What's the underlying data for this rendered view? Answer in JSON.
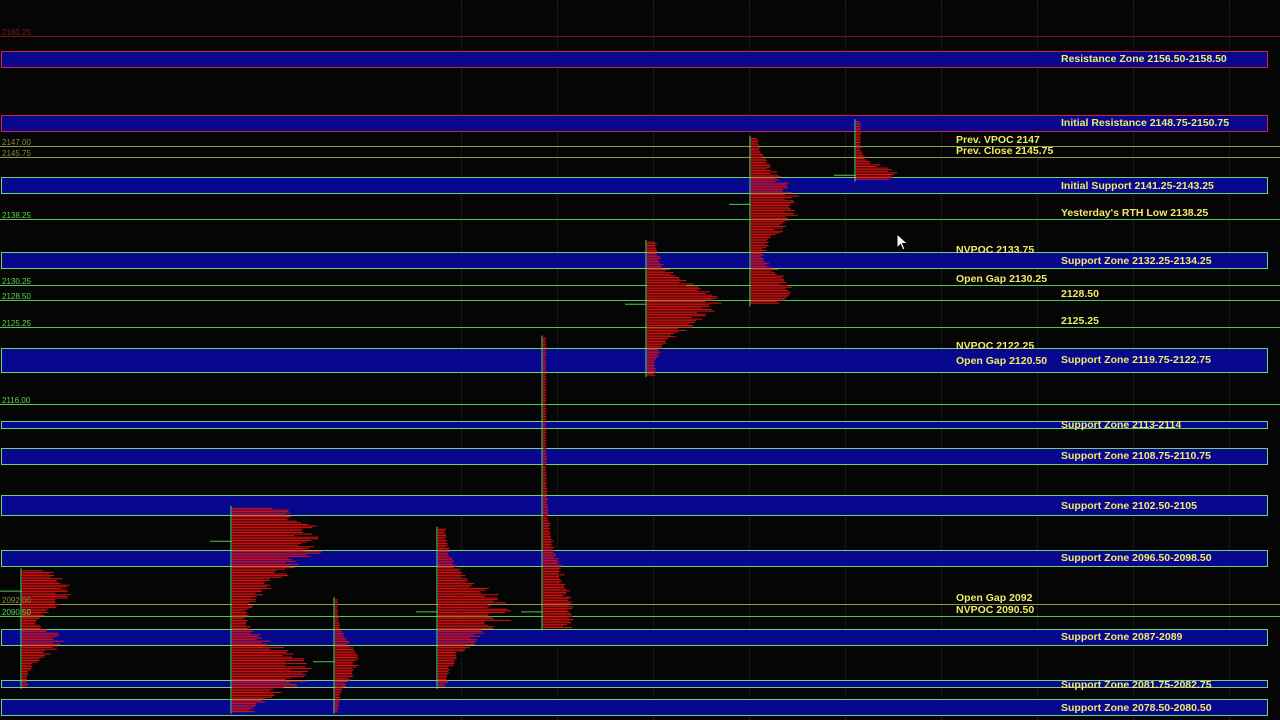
{
  "chart": {
    "price_axis": {
      "top": {
        "label": "2160.25",
        "value": 2160.25,
        "color": "#8b1a1a"
      },
      "bottom": {
        "value": 2078.0
      }
    },
    "price_labels": [
      {
        "label": "2160.25",
        "value": 2160.25,
        "color": "#8b1a1a"
      },
      {
        "label": "2147.00",
        "value": 2147.0,
        "color": "#8a8a3a"
      },
      {
        "label": "2145.75",
        "value": 2145.75,
        "color": "#8a8a3a"
      },
      {
        "label": "2138.25",
        "value": 2138.25,
        "color": "#58d858"
      },
      {
        "label": "2130.25",
        "value": 2130.25,
        "color": "#58d858"
      },
      {
        "label": "2128.50",
        "value": 2128.5,
        "color": "#58d858"
      },
      {
        "label": "2125.25",
        "value": 2125.25,
        "color": "#58d858"
      },
      {
        "label": "2116.00",
        "value": 2116.0,
        "color": "#58d858"
      },
      {
        "label": "2092.00",
        "value": 2092.0,
        "color": "#8a8a3a"
      },
      {
        "label": "2090.50",
        "value": 2090.5,
        "color": "#58d858"
      }
    ],
    "zones": [
      {
        "label": "Resistance Zone 2156.50-2158.50",
        "low": 2156.5,
        "high": 2158.5,
        "kind": "resistance"
      },
      {
        "label": "Initial Resistance 2148.75-2150.75",
        "low": 2148.75,
        "high": 2150.75,
        "kind": "resistance"
      },
      {
        "label": "Initial Support 2141.25-2143.25",
        "low": 2141.25,
        "high": 2143.25,
        "kind": "support"
      },
      {
        "label": "Support Zone 2132.25-2134.25",
        "low": 2132.25,
        "high": 2134.25,
        "kind": "support"
      },
      {
        "label": "Support Zone 2119.75-2122.75",
        "low": 2119.75,
        "high": 2122.75,
        "kind": "support"
      },
      {
        "label": "Support Zone 2113-2114",
        "low": 2113.0,
        "high": 2114.0,
        "kind": "support"
      },
      {
        "label": "Support Zone 2108.75-2110.75",
        "low": 2108.75,
        "high": 2110.75,
        "kind": "support"
      },
      {
        "label": "Support Zone 2102.50-2105",
        "low": 2102.5,
        "high": 2105.0,
        "kind": "support"
      },
      {
        "label": "Support Zone 2096.50-2098.50",
        "low": 2096.5,
        "high": 2098.5,
        "kind": "support"
      },
      {
        "label": "Support Zone 2087-2089",
        "low": 2087.0,
        "high": 2089.0,
        "kind": "support"
      },
      {
        "label": "Support Zone 2081.75-2082.75",
        "low": 2081.75,
        "high": 2082.75,
        "kind": "support"
      },
      {
        "label": "Support Zone 2078.50-2080.50",
        "low": 2078.5,
        "high": 2080.5,
        "kind": "support"
      }
    ],
    "levels": [
      {
        "label": "Prev. VPOC 2147",
        "value": 2147.0,
        "color": "#8f9a45"
      },
      {
        "label": "Prev. Close 2145.75",
        "value": 2145.75,
        "color": "#8f9a45"
      },
      {
        "label": "Yesterday's RTH Low 2138.25",
        "value": 2138.25,
        "color": "#4fc84f",
        "right": true
      },
      {
        "label": "NVPOC 2133.75",
        "value": 2133.75,
        "color": null
      },
      {
        "label": "Open Gap 2130.25",
        "value": 2130.25,
        "color": "#4fc84f"
      },
      {
        "label": "2128.50",
        "value": 2128.5,
        "color": "#4fc84f",
        "right": true
      },
      {
        "label": "2125.25",
        "value": 2125.25,
        "color": "#4fc84f",
        "right": true
      },
      {
        "label": "NVPOC 2122.25",
        "value": 2122.25,
        "color": null
      },
      {
        "label": "Open Gap 2120.50",
        "value": 2120.5,
        "color": null
      },
      {
        "label": "",
        "value": 2116.0,
        "color": "#4fc84f"
      },
      {
        "label": "Open Gap 2092",
        "value": 2092.0,
        "color": "#8f9a45"
      },
      {
        "label": "NVPOC 2090.50",
        "value": 2090.5,
        "color": "#4fc84f"
      }
    ],
    "session_separators": [
      0.36,
      0.435,
      0.51,
      0.585,
      0.66,
      0.735,
      0.81,
      0.885,
      0.96
    ],
    "profiles": [
      {
        "name": "session-1a",
        "top": 2096.0,
        "bottom": 2082.0,
        "x": 0.016,
        "width": 0.04,
        "poc": 2093.5,
        "secondary": 2087.5
      },
      {
        "name": "session-2",
        "top": 2103.5,
        "bottom": 2079.0,
        "x": 0.18,
        "width": 0.075,
        "poc": 2099.5,
        "secondary": 2084.0
      },
      {
        "name": "session-3",
        "top": 2092.5,
        "bottom": 2079.0,
        "x": 0.26,
        "width": 0.02,
        "poc": 2085.0
      },
      {
        "name": "session-4",
        "top": 2101.0,
        "bottom": 2082.0,
        "x": 0.341,
        "width": 0.06,
        "poc": 2091.0
      },
      {
        "name": "session-5",
        "top": 2124.0,
        "bottom": 2089.0,
        "x": 0.423,
        "width": 0.024,
        "poc": 2091.0
      },
      {
        "name": "session-6",
        "top": 2135.5,
        "bottom": 2119.5,
        "x": 0.504,
        "width": 0.06,
        "poc": 2128.0
      },
      {
        "name": "session-7",
        "top": 2148.0,
        "bottom": 2128.0,
        "x": 0.585,
        "width": 0.04,
        "poc": 2140.0,
        "secondary": 2130.0
      },
      {
        "name": "session-8",
        "top": 2150.0,
        "bottom": 2143.0,
        "x": 0.667,
        "width": 0.036,
        "poc": 2143.5
      }
    ],
    "cursor": "arrow-pointer-icon"
  }
}
